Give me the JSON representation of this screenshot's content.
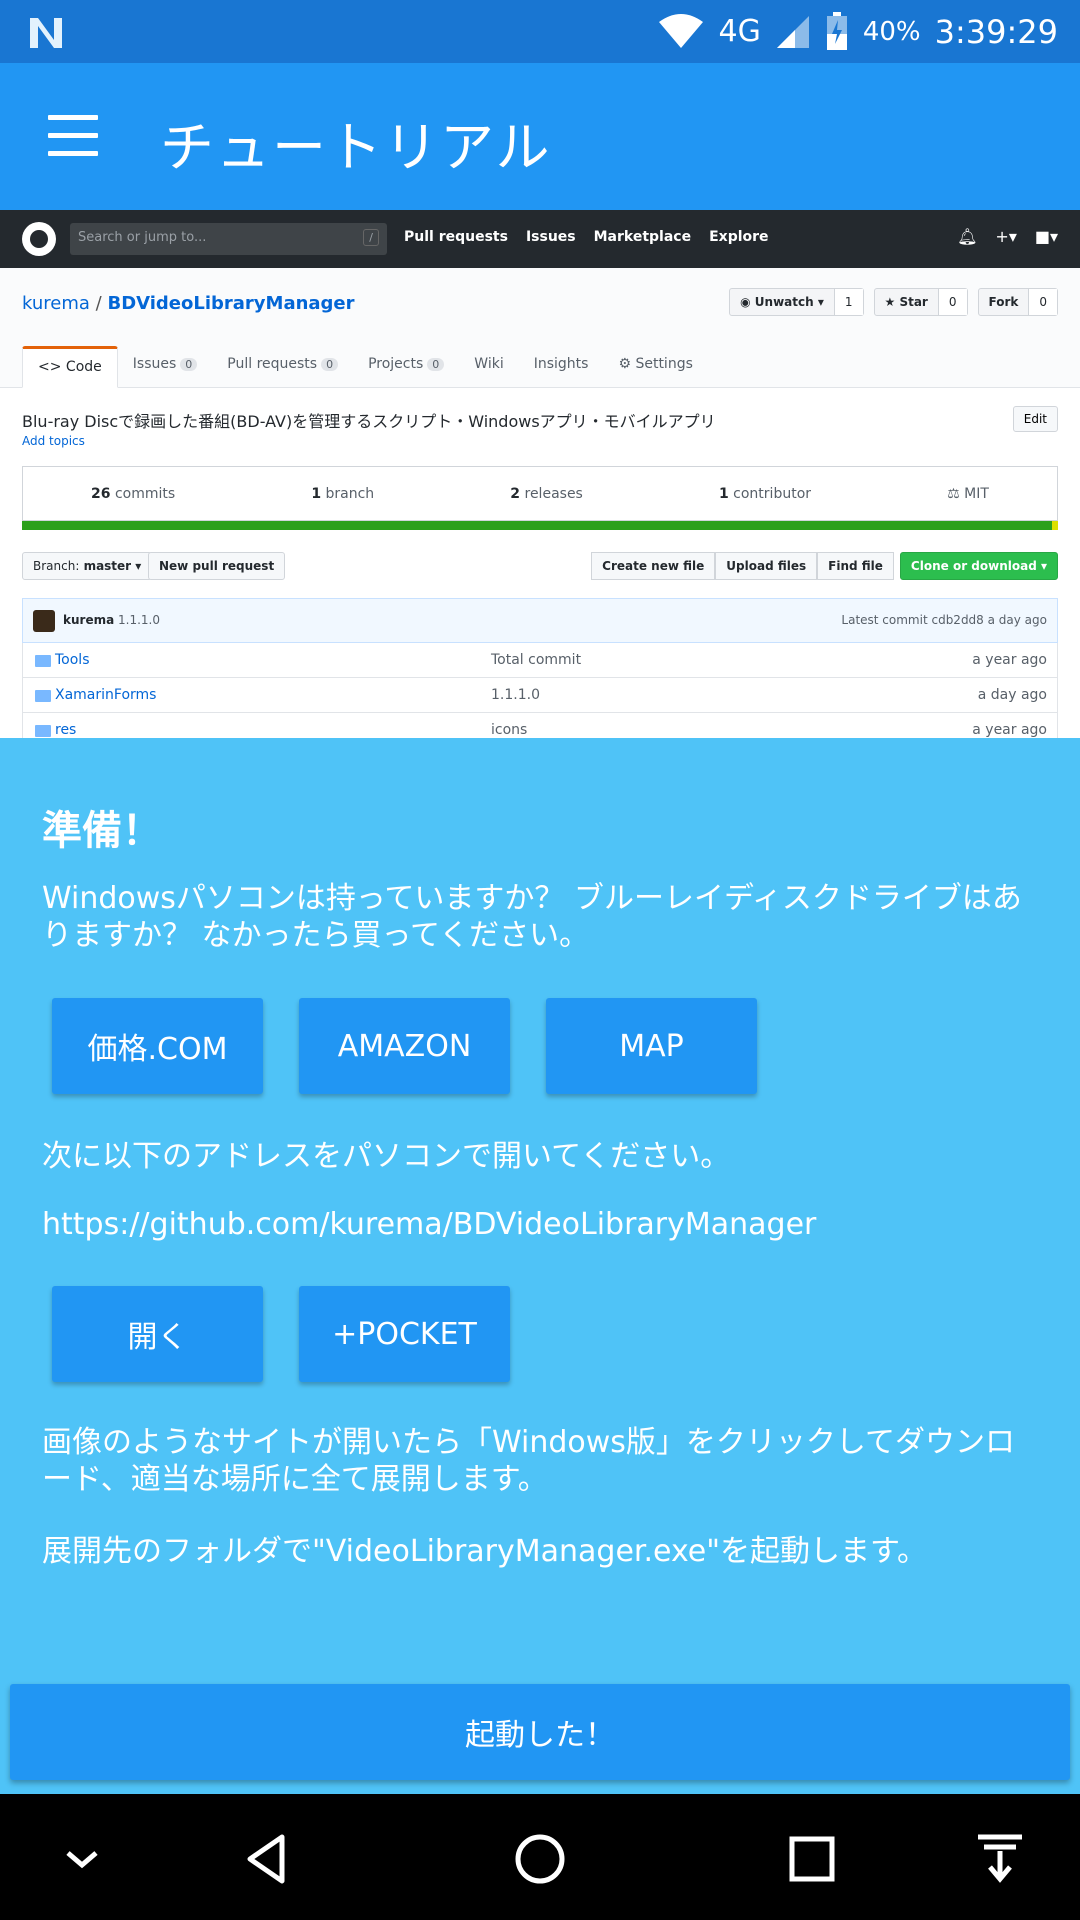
{
  "status": {
    "network": "4G",
    "battery": "40%",
    "time": "3:39:29"
  },
  "appbar": {
    "title": "チュートリアル"
  },
  "github": {
    "search_placeholder": "Search or jump to...",
    "search_key": "/",
    "nav": [
      "Pull requests",
      "Issues",
      "Marketplace",
      "Explore"
    ],
    "owner": "kurema",
    "separator": "/",
    "repo": "BDVideoLibraryManager",
    "watch": {
      "label": "Unwatch",
      "count": "1"
    },
    "star": {
      "label": "Star",
      "count": "0"
    },
    "fork": {
      "label": "Fork",
      "count": "0"
    },
    "tabs": [
      {
        "label": "Code",
        "count": ""
      },
      {
        "label": "Issues",
        "count": "0"
      },
      {
        "label": "Pull requests",
        "count": "0"
      },
      {
        "label": "Projects",
        "count": "0"
      },
      {
        "label": "Wiki",
        "count": ""
      },
      {
        "label": "Insights",
        "count": ""
      },
      {
        "label": "Settings",
        "count": ""
      }
    ],
    "description": "Blu-ray Discで録画した番組(BD-AV)を管理するスクリプト・Windowsアプリ・モバイルアプリ",
    "add_topics": "Add topics",
    "edit": "Edit",
    "summary": [
      {
        "num": "26",
        "label": "commits"
      },
      {
        "num": "1",
        "label": "branch"
      },
      {
        "num": "2",
        "label": "releases"
      },
      {
        "num": "1",
        "label": "contributor"
      },
      {
        "num": "",
        "label": "MIT"
      }
    ],
    "branch_label": "Branch:",
    "branch": "master",
    "new_pr": "New pull request",
    "create_file": "Create new file",
    "upload": "Upload files",
    "find": "Find file",
    "clone": "Clone or download",
    "commit_author": "kurema",
    "commit_msg": "1.1.1.0",
    "latest_commit": "Latest commit cdb2dd8 a day ago",
    "files": [
      {
        "name": "Tools",
        "msg": "Total commit",
        "age": "a year ago"
      },
      {
        "name": "XamarinForms",
        "msg": "1.1.1.0",
        "age": "a day ago"
      },
      {
        "name": "res",
        "msg": "icons",
        "age": "a year ago"
      }
    ]
  },
  "content": {
    "heading": "準備！",
    "intro": "Windowsパソコンは持っていますか？ ブルーレイディスクドライブはありますか？ なかったら買ってください。",
    "buy_buttons": [
      "価格.COM",
      "AMAZON",
      "MAP"
    ],
    "open_address": "次に以下のアドレスをパソコンで開いてください。",
    "url": "https://github.com/kurema/BDVideoLibraryManager",
    "url_buttons": [
      "開く",
      "+POCKET"
    ],
    "download_instr": "画像のようなサイトが開いたら「Windows版」をクリックしてダウンロード、適当な場所に全て展開します。",
    "run_instr": "展開先のフォルダで\"VideoLibraryManager.exe\"を起動します。",
    "started_button": "起動した！"
  }
}
